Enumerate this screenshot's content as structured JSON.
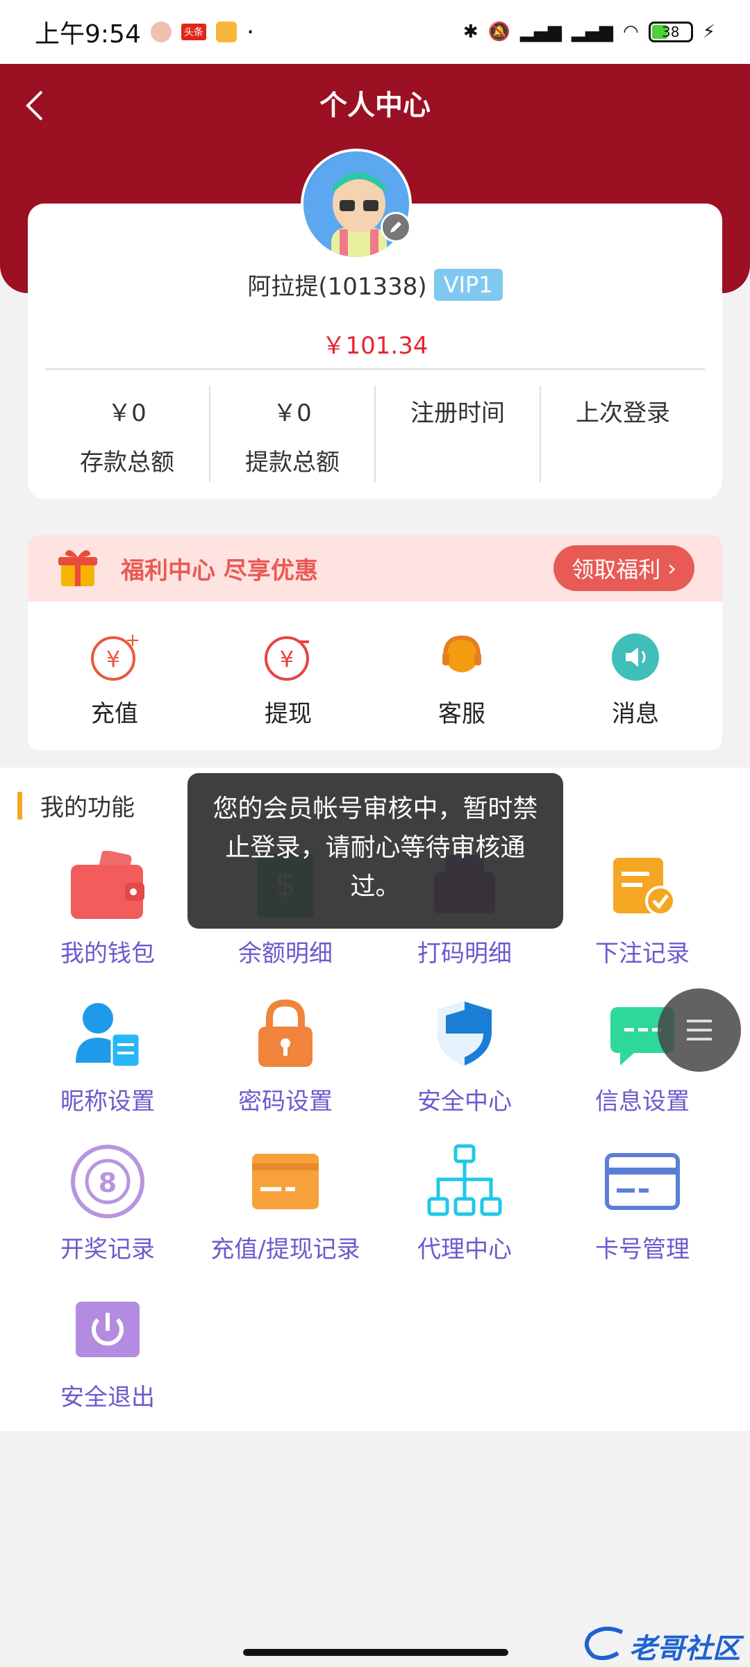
{
  "status_bar": {
    "time": "上午9:54",
    "battery": "38",
    "badge": "头条"
  },
  "header": {
    "title": "个人中心"
  },
  "profile": {
    "name": "阿拉提(101338)",
    "vip": "VIP1",
    "balance": "￥101.34"
  },
  "stats": [
    {
      "value": "￥0",
      "label": "存款总额"
    },
    {
      "value": "￥0",
      "label": "提款总额"
    },
    {
      "value": "",
      "label": "注册时间"
    },
    {
      "value": "",
      "label": "上次登录"
    }
  ],
  "welfare": {
    "text": "福利中心 尽享优惠",
    "button": "领取福利"
  },
  "quick_actions": [
    "充值",
    "提现",
    "客服",
    "消息"
  ],
  "functions": {
    "title": "我的功能",
    "items": [
      "我的钱包",
      "余额明细",
      "打码明细",
      "下注记录",
      "昵称设置",
      "密码设置",
      "安全中心",
      "信息设置",
      "开奖记录",
      "充值/提现记录",
      "代理中心",
      "卡号管理",
      "安全退出"
    ]
  },
  "toast": {
    "message": "您的会员帐号审核中，暂时禁止登录，请耐心等待审核通过。"
  },
  "watermark": {
    "text": "老哥社区"
  },
  "colors": {
    "header": "#9b1023",
    "accent_red": "#e2262e",
    "function_label": "#6a5acd"
  }
}
